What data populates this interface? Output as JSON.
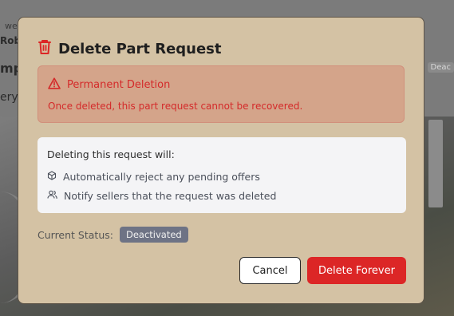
{
  "background": {
    "line1": "we",
    "line2": "Robe",
    "line3": "mp",
    "line4": "ery",
    "badge": "Deac"
  },
  "modal": {
    "title": "Delete Part Request",
    "alert": {
      "title": "Permanent Deletion",
      "body": "Once deleted, this part request cannot be recovered."
    },
    "info": {
      "heading": "Deleting this request will:",
      "items": [
        {
          "icon": "cube-icon",
          "text": "Automatically reject any pending offers"
        },
        {
          "icon": "users-icon",
          "text": "Notify sellers that the request was deleted"
        }
      ]
    },
    "status": {
      "label": "Current Status:",
      "value": "Deactivated"
    },
    "buttons": {
      "cancel": "Cancel",
      "delete": "Delete Forever"
    }
  },
  "colors": {
    "danger": "#dc2626",
    "modal_bg": "#d4c2a4",
    "badge_bg": "#6e7385"
  }
}
